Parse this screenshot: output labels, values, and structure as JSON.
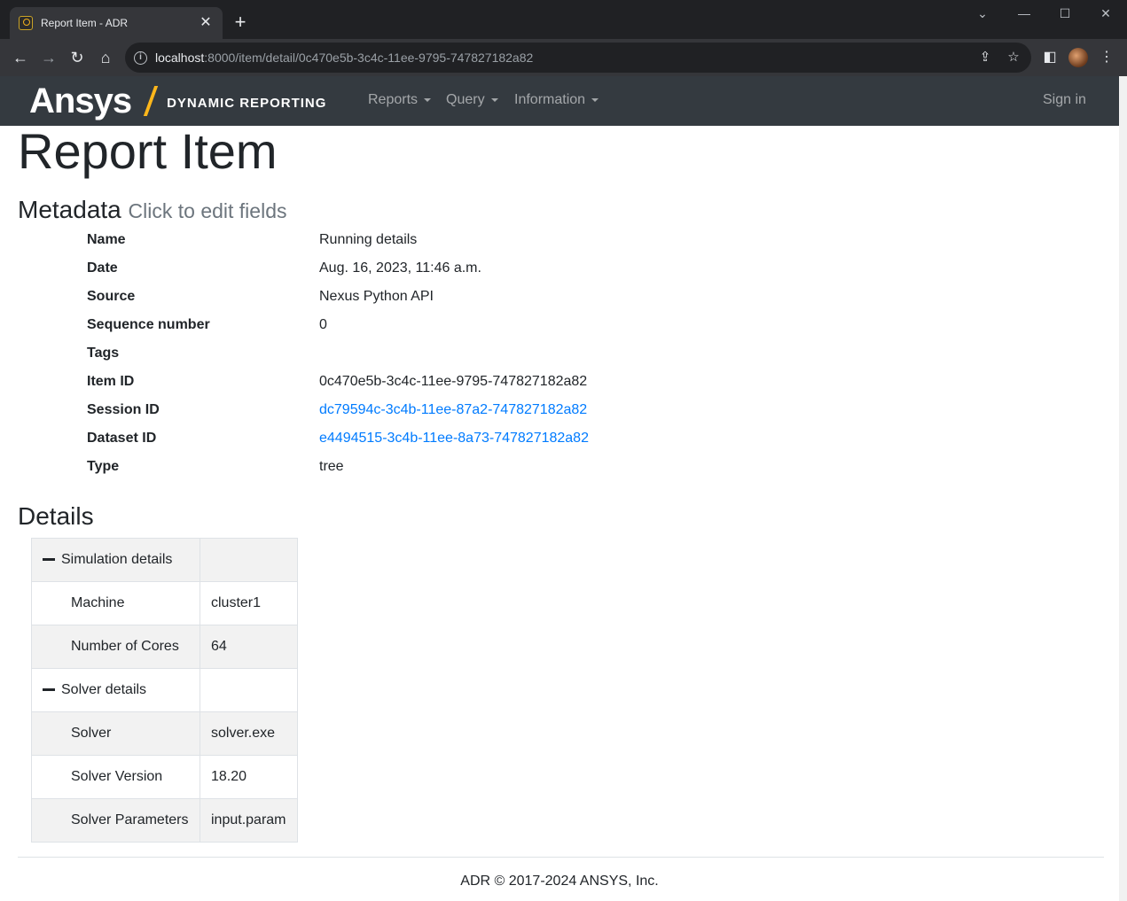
{
  "browser": {
    "tab_title": "Report Item - ADR",
    "tab_close": "✕",
    "new_tab": "+",
    "url_host": "localhost",
    "url_rest": ":8000/item/detail/0c470e5b-3c4c-11ee-9795-747827182a82"
  },
  "navbar": {
    "brand_logo": "Ansys",
    "brand_sub": "DYNAMIC REPORTING",
    "menu": [
      "Reports",
      "Query",
      "Information"
    ],
    "sign_in": "Sign in"
  },
  "page": {
    "title": "Report Item",
    "metadata_heading": "Metadata",
    "metadata_hint": "Click to edit fields",
    "metadata": [
      {
        "key": "Name",
        "value": "Running details",
        "link": false
      },
      {
        "key": "Date",
        "value": "Aug. 16, 2023, 11:46 a.m.",
        "link": false
      },
      {
        "key": "Source",
        "value": "Nexus Python API",
        "link": false
      },
      {
        "key": "Sequence number",
        "value": "0",
        "link": false
      },
      {
        "key": "Tags",
        "value": "",
        "link": false
      },
      {
        "key": "Item ID",
        "value": "0c470e5b-3c4c-11ee-9795-747827182a82",
        "link": false
      },
      {
        "key": "Session ID",
        "value": "dc79594c-3c4b-11ee-87a2-747827182a82",
        "link": true
      },
      {
        "key": "Dataset ID",
        "value": "e4494515-3c4b-11ee-8a73-747827182a82",
        "link": true
      },
      {
        "key": "Type",
        "value": "tree",
        "link": false
      }
    ],
    "details_heading": "Details",
    "tree": [
      {
        "key": "Simulation details",
        "value": "",
        "group": true
      },
      {
        "key": "Machine",
        "value": "cluster1",
        "group": false
      },
      {
        "key": "Number of Cores",
        "value": "64",
        "group": false
      },
      {
        "key": "Solver details",
        "value": "",
        "group": true
      },
      {
        "key": "Solver",
        "value": "solver.exe",
        "group": false
      },
      {
        "key": "Solver Version",
        "value": "18.20",
        "group": false
      },
      {
        "key": "Solver Parameters",
        "value": "input.param",
        "group": false
      }
    ],
    "footer": "ADR © 2017-2024 ANSYS, Inc."
  },
  "colors": {
    "navbar_bg": "#343a40",
    "link": "#007bff",
    "brand_accent": "#ffb71b"
  }
}
